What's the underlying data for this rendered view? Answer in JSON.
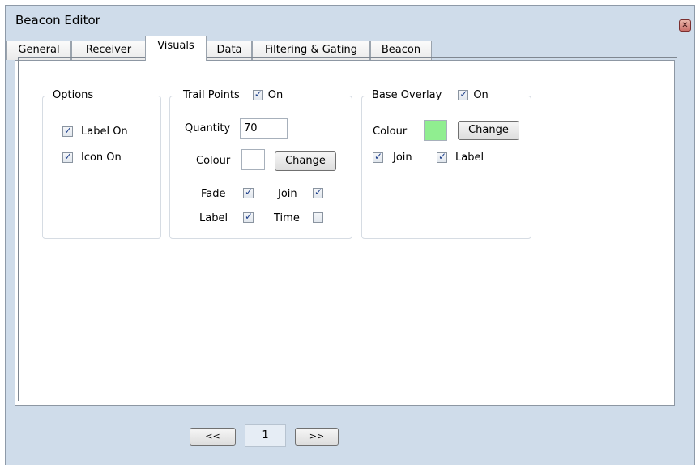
{
  "window": {
    "title": "Beacon Editor",
    "close_glyph": "✕"
  },
  "tabs": [
    {
      "label": "General",
      "active": false
    },
    {
      "label": "Receiver",
      "active": false
    },
    {
      "label": "Visuals",
      "active": true
    },
    {
      "label": "Data",
      "active": false
    },
    {
      "label": "Filtering & Gating",
      "active": false
    },
    {
      "label": "Beacon",
      "active": false
    }
  ],
  "options": {
    "title": "Options",
    "label_on": {
      "label": "Label On",
      "checked": true
    },
    "icon_on": {
      "label": "Icon On",
      "checked": true
    }
  },
  "trail_points": {
    "title": "Trail Points",
    "on": {
      "label": "On",
      "checked": true
    },
    "quantity_label": "Quantity",
    "quantity_value": "70",
    "colour_label": "Colour",
    "colour_value": "#ffffff",
    "change_label": "Change",
    "fade": {
      "label": "Fade",
      "checked": true
    },
    "join": {
      "label": "Join",
      "checked": true
    },
    "label": {
      "label": "Label",
      "checked": true
    },
    "time": {
      "label": "Time",
      "checked": false
    }
  },
  "base_overlay": {
    "title": "Base Overlay",
    "on": {
      "label": "On",
      "checked": true
    },
    "colour_label": "Colour",
    "colour_value": "#90ee90",
    "change_label": "Change",
    "join": {
      "label": "Join",
      "checked": true
    },
    "label": {
      "label": "Label",
      "checked": true
    }
  },
  "pager": {
    "prev_label": "<<",
    "page": "1",
    "next_label": ">>"
  }
}
